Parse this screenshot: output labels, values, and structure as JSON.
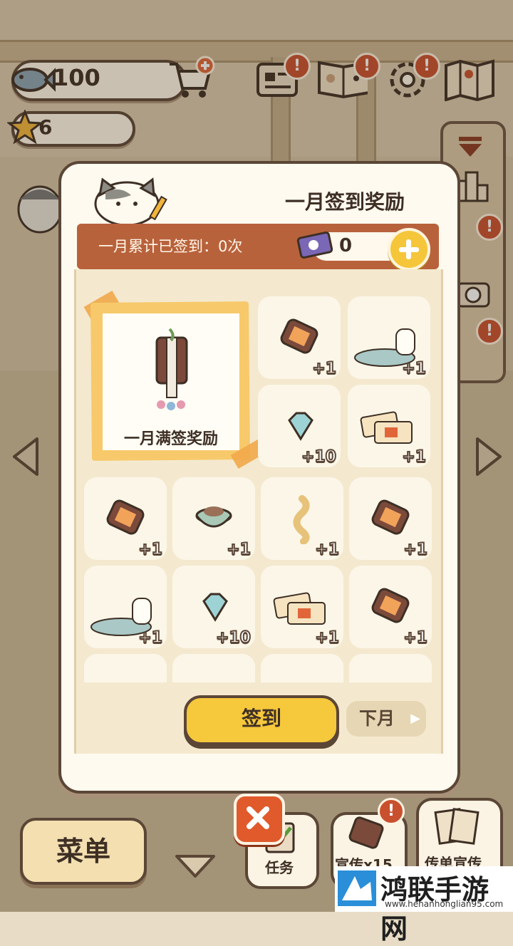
{
  "hud": {
    "fish_count": "100",
    "star_count": "6"
  },
  "modal": {
    "title": "一月签到奖励",
    "banner_text": "一月累计已签到：0次",
    "ticket_count": "0",
    "big_reward_label": "一月满签奖励",
    "rewards": [
      {
        "item": "tablet-icon",
        "qty": "+1"
      },
      {
        "item": "cat-bed-icon",
        "qty": "+1"
      },
      {
        "item": "diamond-icon",
        "qty": "+10"
      },
      {
        "item": "tickets-icon",
        "qty": "+1"
      },
      {
        "item": "tablet-icon",
        "qty": "+1"
      },
      {
        "item": "food-bowl-icon",
        "qty": "+1"
      },
      {
        "item": "snake-toy-icon",
        "qty": "+1"
      },
      {
        "item": "tablet-icon",
        "qty": "+1"
      },
      {
        "item": "cat-bed-icon",
        "qty": "+1"
      },
      {
        "item": "diamond-icon",
        "qty": "+10"
      },
      {
        "item": "tickets-icon",
        "qty": "+1"
      },
      {
        "item": "tablet-icon",
        "qty": "+1"
      }
    ],
    "sign_button": "签到",
    "next_month_button": "下月"
  },
  "bottom": {
    "menu_label": "菜单",
    "task_label": "任务",
    "promo_label": "宣传x15",
    "flyer_label": "传单宣传"
  },
  "watermark": {
    "main": "鸿联手游网",
    "sub": "www.henanhonglian95.com"
  }
}
